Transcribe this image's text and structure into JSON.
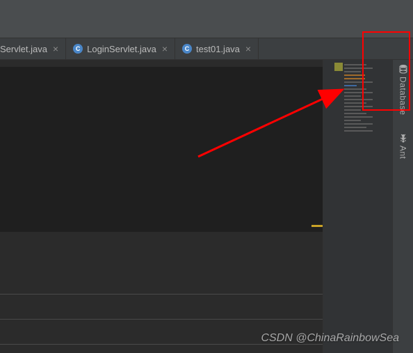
{
  "tabs": [
    {
      "label": "Servlet.java",
      "partial": true
    },
    {
      "label": "LoginServlet.java",
      "partial": false
    },
    {
      "label": "test01.java",
      "partial": false
    }
  ],
  "sidebar_tools": {
    "database_label": "Database",
    "ant_label": "Ant"
  },
  "watermark": "CSDN @ChinaRainbowSea",
  "annotation": {
    "highlight_target": "database-tool",
    "color": "#ff0000"
  }
}
